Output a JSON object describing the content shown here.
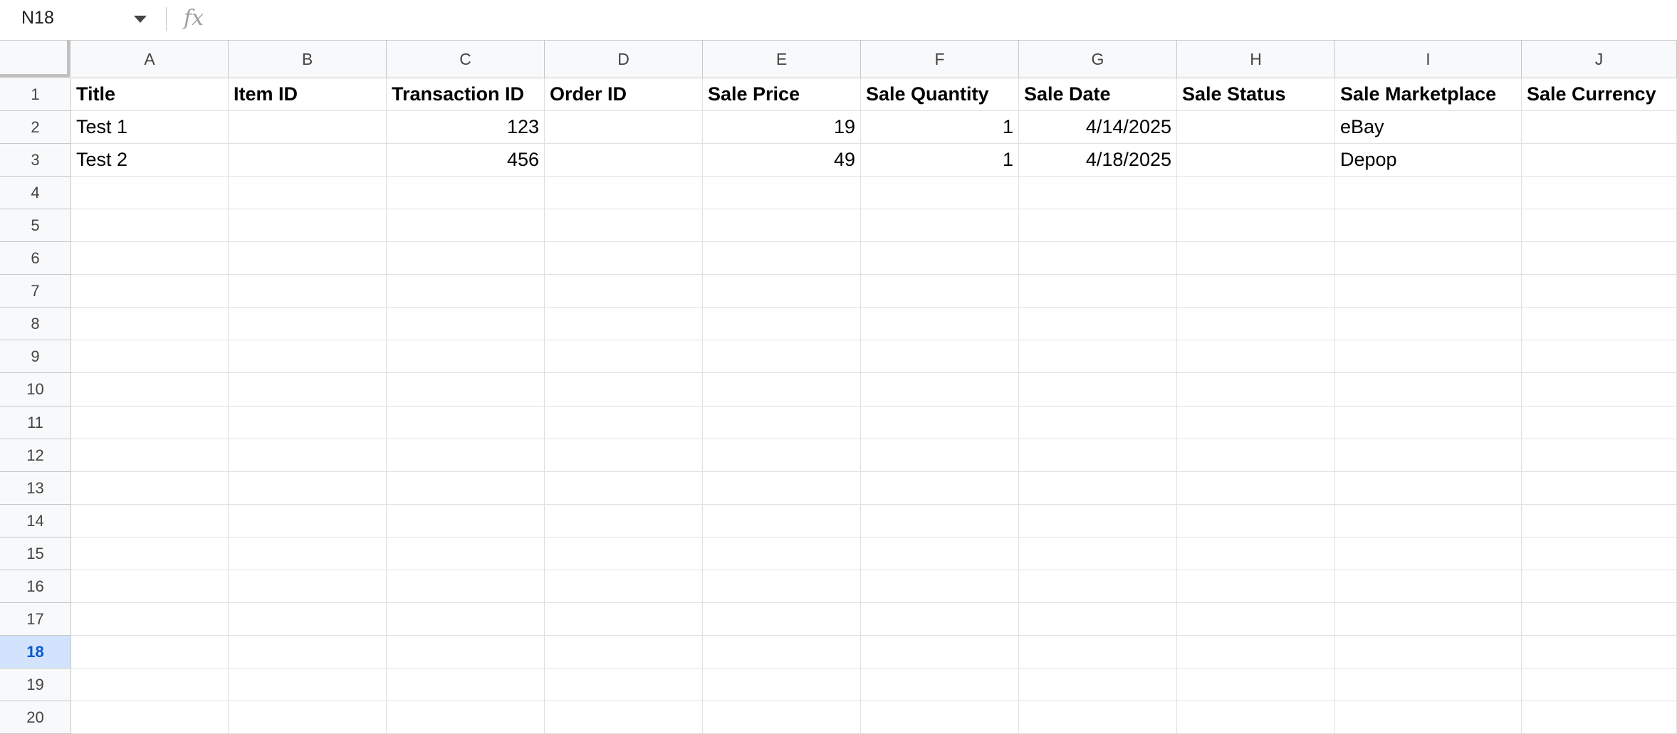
{
  "formula_bar": {
    "name_box": "N18",
    "fx_icon": "fx-icon",
    "formula": ""
  },
  "sheet": {
    "columns": [
      "A",
      "B",
      "C",
      "D",
      "E",
      "F",
      "G",
      "H",
      "I",
      "J"
    ],
    "rows": [
      "1",
      "2",
      "3",
      "4",
      "5",
      "6",
      "7",
      "8",
      "9",
      "10",
      "11",
      "12",
      "13",
      "14",
      "15",
      "16",
      "17",
      "18",
      "19",
      "20"
    ],
    "active_row": "18",
    "header_row": [
      "Title",
      "Item ID",
      "Transaction ID",
      "Order ID",
      "Sale Price",
      "Sale Quantity",
      "Sale Date",
      "Sale Status",
      "Sale Marketplace",
      "Sale Currency"
    ],
    "data_rows": [
      [
        "Test 1",
        "",
        "123",
        "",
        "19",
        "1",
        "4/14/2025",
        "",
        "eBay",
        ""
      ],
      [
        "Test 2",
        "",
        "456",
        "",
        "49",
        "1",
        "4/18/2025",
        "",
        "Depop",
        ""
      ]
    ],
    "right_aligned_columns": [
      "C",
      "E",
      "F",
      "G"
    ]
  },
  "colors": {
    "header_bg": "#f8f9fa",
    "active_header_bg": "#d3e3fd",
    "active_header_text": "#0b57d0",
    "grid_line": "#e1e1e1"
  }
}
